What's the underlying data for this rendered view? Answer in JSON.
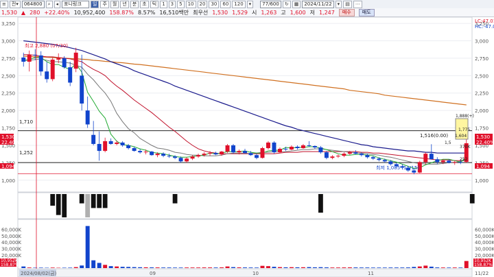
{
  "toolbar": {
    "code": "064800",
    "name": "포니링크",
    "periods": [
      "주",
      "월",
      "년",
      "분",
      "초",
      "틱"
    ],
    "intervals": [
      "1",
      "3",
      "5",
      "10",
      "20",
      "30",
      "60",
      "120"
    ],
    "count": "77/600",
    "date": "2024/11/22"
  },
  "quote": {
    "price": "1,530",
    "change": "280",
    "change_pct": "+22.40%",
    "volume": "10,952,400",
    "volume_pct": "158.87%",
    "turnover": "8.57%",
    "amount": "16,510백만",
    "cond_label": "최우선",
    "best_ask": "1,530",
    "best_bid": "1,529",
    "open_label": "시",
    "open": "1,263",
    "high_label": "고",
    "high": "1,600",
    "low_label": "저",
    "low": "1,247",
    "buy_label": "매수",
    "sell_label": "매도"
  },
  "price_axis": {
    "ticks": [
      "3,250",
      "3,000",
      "2,750",
      "2,500",
      "2,250",
      "2,000",
      "1,750",
      "1,500",
      "1,250",
      "1,000"
    ]
  },
  "volume_axis": {
    "ticks": [
      "60,000K",
      "50,000K",
      "40,000K",
      "30,000K",
      "20,000K",
      "10,000K"
    ]
  },
  "annotations": {
    "lc": "LC:47.01",
    "hc": "HC:-47.08",
    "high_note": "최고 2,880 (07/30)",
    "low_note": "최저 1,085 (11/15)",
    "mid_note": "1,516(0.00)",
    "left_1710": "1,710",
    "left_1252": "1,252",
    "left_1530": "1,530",
    "left_pct": "22.40%",
    "left_1094": "1,094",
    "right_1530": "1,530",
    "right_pct": "22.40%",
    "right_1094": "1,094",
    "box_top": "1,888(+)",
    "box_mid": "1,775",
    "lbl_1604": "1,604",
    "lbl_15": "1,5",
    "lbl_370": "370K",
    "lbl_252": "252",
    "vol_left_1": "10,952K",
    "vol_left_2": "158.87%",
    "vol_right_1": "10,952K",
    "vol_right_2": "158.87%"
  },
  "x_axis": {
    "labels": [
      "2024/08/02(금)",
      "09",
      "10",
      "11",
      "11/22"
    ]
  },
  "colors": {
    "up": "#e0102a",
    "down": "#1144cc",
    "ma5": "#22aa33",
    "ma10": "#777777",
    "ma20": "#c0102a",
    "ma60": "#1a1a8c",
    "ma120": "#d07020"
  },
  "chart_data": {
    "type": "candlestick",
    "title": "",
    "ohlc": [
      [
        2760,
        2830,
        2630,
        2700
      ],
      [
        2700,
        2860,
        2560,
        2800
      ],
      [
        2800,
        2880,
        2720,
        2790
      ],
      [
        2790,
        2850,
        2500,
        2560
      ],
      [
        2560,
        2700,
        2400,
        2450
      ],
      [
        2450,
        2760,
        2420,
        2730
      ],
      [
        2730,
        2820,
        2680,
        2750
      ],
      [
        2750,
        2780,
        2600,
        2620
      ],
      [
        2620,
        2700,
        2350,
        2400
      ],
      [
        2600,
        2900,
        2550,
        2830
      ],
      [
        2500,
        2800,
        2000,
        2100
      ],
      [
        2000,
        2200,
        1750,
        1800
      ],
      [
        1650,
        1850,
        1500,
        1520
      ],
      [
        1520,
        1700,
        1280,
        1420
      ],
      [
        1420,
        1610,
        1400,
        1560
      ],
      [
        1560,
        1600,
        1510,
        1520
      ],
      [
        1520,
        1570,
        1500,
        1540
      ],
      [
        1540,
        1560,
        1480,
        1500
      ],
      [
        1500,
        1520,
        1440,
        1460
      ],
      [
        1460,
        1480,
        1410,
        1420
      ],
      [
        1420,
        1450,
        1380,
        1400
      ],
      [
        1400,
        1440,
        1370,
        1410
      ],
      [
        1410,
        1420,
        1350,
        1360
      ],
      [
        1360,
        1400,
        1330,
        1380
      ],
      [
        1380,
        1400,
        1330,
        1350
      ],
      [
        1350,
        1380,
        1320,
        1340
      ],
      [
        1340,
        1360,
        1300,
        1320
      ],
      [
        1320,
        1340,
        1250,
        1270
      ],
      [
        1270,
        1330,
        1250,
        1310
      ],
      [
        1310,
        1360,
        1290,
        1340
      ],
      [
        1340,
        1380,
        1320,
        1360
      ],
      [
        1360,
        1400,
        1340,
        1380
      ],
      [
        1380,
        1420,
        1350,
        1390
      ],
      [
        1390,
        1410,
        1360,
        1370
      ],
      [
        1370,
        1420,
        1350,
        1410
      ],
      [
        1410,
        1520,
        1390,
        1500
      ],
      [
        1500,
        1520,
        1380,
        1400
      ],
      [
        1400,
        1440,
        1370,
        1420
      ],
      [
        1420,
        1450,
        1380,
        1390
      ],
      [
        1390,
        1420,
        1350,
        1360
      ],
      [
        1360,
        1380,
        1300,
        1320
      ],
      [
        1320,
        1480,
        1310,
        1460
      ],
      [
        1460,
        1560,
        1440,
        1540
      ],
      [
        1540,
        1560,
        1380,
        1400
      ],
      [
        1400,
        1470,
        1390,
        1450
      ],
      [
        1450,
        1480,
        1420,
        1440
      ],
      [
        1440,
        1500,
        1430,
        1480
      ],
      [
        1480,
        1500,
        1440,
        1460
      ],
      [
        1460,
        1520,
        1450,
        1500
      ],
      [
        1500,
        1560,
        1480,
        1490
      ],
      [
        1490,
        1500,
        1450,
        1470
      ],
      [
        1470,
        1490,
        1380,
        1400
      ],
      [
        1400,
        1420,
        1300,
        1320
      ],
      [
        1320,
        1360,
        1300,
        1340
      ],
      [
        1340,
        1370,
        1320,
        1350
      ],
      [
        1350,
        1400,
        1330,
        1380
      ],
      [
        1380,
        1420,
        1360,
        1400
      ],
      [
        1400,
        1430,
        1370,
        1380
      ],
      [
        1380,
        1400,
        1340,
        1360
      ],
      [
        1360,
        1380,
        1310,
        1330
      ],
      [
        1330,
        1350,
        1290,
        1310
      ],
      [
        1310,
        1330,
        1270,
        1290
      ],
      [
        1290,
        1310,
        1250,
        1270
      ],
      [
        1270,
        1290,
        1210,
        1230
      ],
      [
        1230,
        1250,
        1180,
        1200
      ],
      [
        1200,
        1230,
        1160,
        1180
      ],
      [
        1180,
        1200,
        1120,
        1140
      ],
      [
        1140,
        1170,
        1085,
        1110
      ],
      [
        1110,
        1280,
        1100,
        1260
      ],
      [
        1260,
        1400,
        1230,
        1380
      ],
      [
        1380,
        1516,
        1350,
        1300
      ],
      [
        1300,
        1330,
        1230,
        1260
      ],
      [
        1260,
        1300,
        1230,
        1280
      ],
      [
        1280,
        1300,
        1240,
        1250
      ],
      [
        1250,
        1280,
        1220,
        1260
      ],
      [
        1260,
        1300,
        1230,
        1250
      ],
      [
        1263,
        1600,
        1247,
        1530
      ]
    ],
    "volume_k": [
      2500,
      900,
      600,
      700,
      500,
      800,
      500,
      600,
      700,
      1500,
      4000,
      65000,
      12000,
      8000,
      5000,
      3000,
      2500,
      2000,
      1800,
      1500,
      1300,
      1200,
      1100,
      1000,
      900,
      900,
      800,
      800,
      900,
      900,
      900,
      1000,
      1000,
      900,
      1100,
      2500,
      1500,
      1100,
      1000,
      900,
      800,
      3500,
      3000,
      2000,
      1500,
      1200,
      1400,
      1200,
      1300,
      1500,
      1200,
      1400,
      1100,
      900,
      900,
      1000,
      1100,
      1000,
      900,
      900,
      800,
      800,
      800,
      900,
      900,
      900,
      1000,
      1800,
      2500,
      3800,
      2200,
      1000,
      900,
      800,
      900,
      800,
      10952
    ],
    "ma5": [
      2720,
      2730,
      2760,
      2760,
      2700,
      2660,
      2660,
      2620,
      2590,
      2670,
      2550,
      2260,
      2130,
      1990,
      1890,
      1660,
      1560,
      1510,
      1500,
      1480,
      1450,
      1430,
      1400,
      1390,
      1380,
      1360,
      1340,
      1330,
      1330,
      1340,
      1350,
      1360,
      1390,
      1380,
      1390,
      1410,
      1410,
      1410,
      1420,
      1400,
      1390,
      1390,
      1420,
      1430,
      1430,
      1470,
      1460,
      1470,
      1470,
      1480,
      1480,
      1460,
      1440,
      1410,
      1380,
      1360,
      1360,
      1370,
      1370,
      1360,
      1350,
      1320,
      1300,
      1280,
      1260,
      1230,
      1200,
      1170,
      1180,
      1220,
      1250,
      1280,
      1300,
      1300,
      1280,
      1260,
      1330
    ],
    "ma10": [
      2720,
      2720,
      2730,
      2740,
      2720,
      2700,
      2700,
      2690,
      2680,
      2650,
      2620,
      2520,
      2440,
      2340,
      2250,
      2130,
      1960,
      1840,
      1740,
      1680,
      1600,
      1550,
      1500,
      1460,
      1450,
      1430,
      1400,
      1390,
      1370,
      1360,
      1360,
      1350,
      1350,
      1350,
      1360,
      1380,
      1390,
      1390,
      1390,
      1380,
      1390,
      1400,
      1400,
      1410,
      1410,
      1410,
      1420,
      1430,
      1440,
      1440,
      1450,
      1450,
      1440,
      1430,
      1420,
      1410,
      1400,
      1390,
      1390,
      1380,
      1370,
      1360,
      1340,
      1330,
      1310,
      1290,
      1270,
      1250,
      1240,
      1230,
      1230,
      1230,
      1240,
      1250,
      1250,
      1270,
      1290
    ],
    "ma20": [
      2800,
      2800,
      2790,
      2780,
      2770,
      2770,
      2760,
      2750,
      2740,
      2720,
      2700,
      2640,
      2590,
      2550,
      2500,
      2420,
      2350,
      2290,
      2220,
      2150,
      2090,
      2030,
      1970,
      1900,
      1830,
      1760,
      1700,
      1630,
      1560,
      1500,
      1450,
      1420,
      1400,
      1390,
      1380,
      1380,
      1380,
      1380,
      1380,
      1380,
      1380,
      1380,
      1380,
      1380,
      1390,
      1400,
      1400,
      1400,
      1410,
      1410,
      1410,
      1410,
      1410,
      1410,
      1410,
      1410,
      1410,
      1410,
      1400,
      1400,
      1390,
      1390,
      1380,
      1370,
      1360,
      1350,
      1340,
      1330,
      1320,
      1310,
      1300,
      1290,
      1290,
      1290,
      1280,
      1280,
      1280
    ],
    "ma60": [
      3000,
      2990,
      2980,
      2970,
      2960,
      2950,
      2930,
      2920,
      2900,
      2880,
      2860,
      2830,
      2800,
      2770,
      2740,
      2700,
      2670,
      2640,
      2610,
      2570,
      2540,
      2510,
      2480,
      2450,
      2420,
      2390,
      2350,
      2320,
      2290,
      2260,
      2230,
      2200,
      2170,
      2140,
      2110,
      2080,
      2050,
      2020,
      1990,
      1960,
      1930,
      1900,
      1870,
      1840,
      1810,
      1780,
      1760,
      1730,
      1710,
      1690,
      1670,
      1650,
      1630,
      1610,
      1590,
      1570,
      1550,
      1530,
      1510,
      1500,
      1480,
      1470,
      1460,
      1450,
      1440,
      1430,
      1420,
      1420,
      1410,
      1400,
      1400,
      1390,
      1390,
      1390,
      1390,
      1390,
      1390
    ],
    "ma120": [
      2780,
      2775,
      2770,
      2770,
      2765,
      2760,
      2755,
      2750,
      2745,
      2740,
      2735,
      2730,
      2720,
      2715,
      2705,
      2700,
      2690,
      2685,
      2675,
      2665,
      2660,
      2650,
      2640,
      2630,
      2620,
      2610,
      2600,
      2590,
      2580,
      2570,
      2560,
      2550,
      2540,
      2530,
      2520,
      2510,
      2500,
      2490,
      2480,
      2470,
      2460,
      2450,
      2440,
      2430,
      2420,
      2410,
      2400,
      2390,
      2380,
      2370,
      2360,
      2350,
      2340,
      2330,
      2320,
      2310,
      2290,
      2280,
      2270,
      2260,
      2250,
      2240,
      2220,
      2210,
      2200,
      2190,
      2180,
      2170,
      2160,
      2150,
      2140,
      2130,
      2120,
      2110,
      2100,
      2090,
      2080
    ],
    "ylim": [
      880,
      3300
    ],
    "volume_ylim": [
      0,
      72000
    ],
    "hlines": [
      1710,
      1252,
      1094
    ]
  }
}
